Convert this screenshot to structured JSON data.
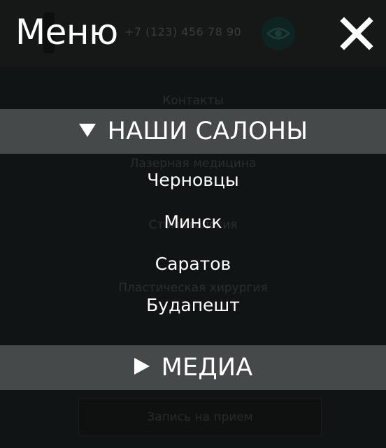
{
  "background": {
    "phone": "+7 (123) 456 78 90",
    "items": [
      "Контакты",
      "Лазерная медицина",
      "Стоматология",
      "Пластическая хирургия"
    ],
    "appointment_label": "Запись на прием"
  },
  "menu": {
    "title": "Меню",
    "sections": [
      {
        "label": "НАШИ САЛОНЫ",
        "expanded": true,
        "arrow": "▼",
        "items": [
          "Черновцы",
          "Минск",
          "Саратов",
          "Будапешт"
        ]
      },
      {
        "label": "МЕДИА",
        "expanded": false,
        "arrow": "▶"
      }
    ]
  },
  "colors": {
    "overlay": "#111414",
    "section_bar": "#464949",
    "text": "#ffffff"
  },
  "icons": {
    "close": "close-icon",
    "expanded": "triangle-down-icon",
    "collapsed": "triangle-right-icon",
    "eye": "eye-icon",
    "phone": "phone-icon"
  }
}
